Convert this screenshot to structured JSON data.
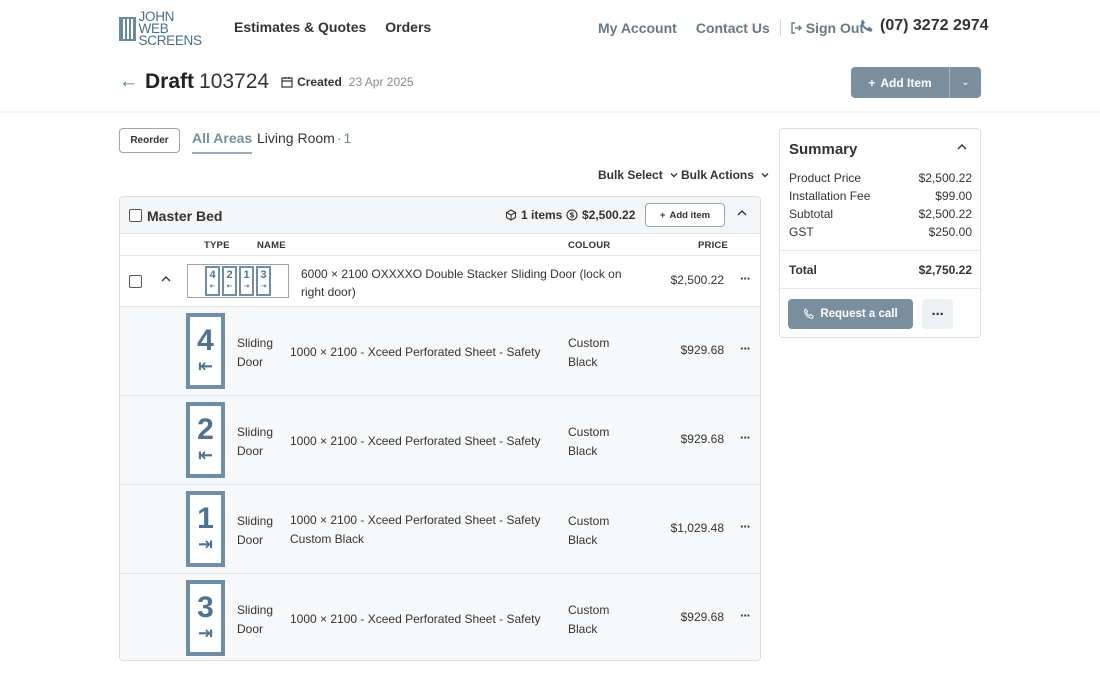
{
  "header": {
    "logo_text_line1": "JOHN WEB",
    "logo_text_line2": "SCREENS",
    "nav_left": [
      "Estimates & Quotes",
      "Orders"
    ],
    "my_account": "My Account",
    "contact_us": "Contact Us",
    "sign_out": "Sign Out",
    "phone": "(07) 3272 2974"
  },
  "title": {
    "status": "Draft",
    "number": "103724",
    "created_label": "Created",
    "created_date": "23 Apr 2025",
    "add_item_label": "Add Item"
  },
  "tabs": {
    "reorder_label": "Reorder",
    "all_areas": "All Areas",
    "living_room": "Living Room",
    "living_room_count": "1"
  },
  "bulk": {
    "select_label": "Bulk Select",
    "actions_label": "Bulk Actions"
  },
  "group": {
    "title": "Master Bed",
    "items_count": "1 items",
    "total": "$2,500.22",
    "add_item_label": "Add item"
  },
  "columns": {
    "type": "TYPE",
    "name": "NAME",
    "colour": "COLOUR",
    "price": "PRICE"
  },
  "main_item": {
    "name": "6000 × 2100 OXXXXO Double Stacker Sliding Door (lock on right door)",
    "price": "$2,500.22",
    "mini_panels": [
      {
        "num": "4",
        "arrow": "⇤"
      },
      {
        "num": "2",
        "arrow": "⇤"
      },
      {
        "num": "1",
        "arrow": "⇥"
      },
      {
        "num": "3",
        "arrow": "⇥"
      }
    ]
  },
  "sub_items": [
    {
      "num": "4",
      "arrow": "⇤",
      "type": "Sliding Door",
      "desc": "1000 × 2100 - Xceed Perforated Sheet - Safety",
      "colour": "Custom Black",
      "price": "$929.68"
    },
    {
      "num": "2",
      "arrow": "⇤",
      "type": "Sliding Door",
      "desc": "1000 × 2100 - Xceed Perforated Sheet - Safety",
      "colour": "Custom Black",
      "price": "$929.68"
    },
    {
      "num": "1",
      "arrow": "⇥",
      "type": "Sliding Door",
      "desc": "1000 × 2100 - Xceed Perforated Sheet - Safety Custom Black",
      "colour": "Custom Black",
      "price": "$1,029.48"
    },
    {
      "num": "3",
      "arrow": "⇥",
      "type": "Sliding Door",
      "desc": "1000 × 2100 - Xceed Perforated Sheet - Safety",
      "colour": "Custom Black",
      "price": "$929.68"
    }
  ],
  "summary": {
    "title": "Summary",
    "lines": [
      {
        "label": "Product Price",
        "value": "$2,500.22"
      },
      {
        "label": "Installation Fee",
        "value": "$99.00"
      },
      {
        "label": "Subtotal",
        "value": "$2,500.22"
      },
      {
        "label": "GST",
        "value": "$250.00"
      }
    ],
    "total_label": "Total",
    "total_value": "$2,750.22",
    "request_call_label": "Request a call"
  },
  "colors": {
    "accent": "#7a8f9e",
    "brand_blue": "#4f7290"
  }
}
